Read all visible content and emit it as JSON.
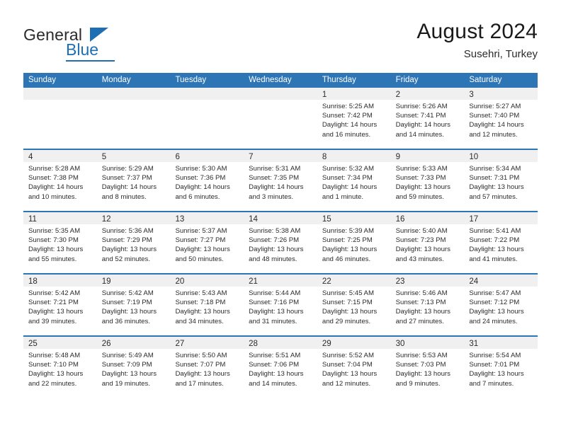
{
  "brand": {
    "name_top": "General",
    "name_bottom": "Blue",
    "triangle_icon": "blue-triangle-icon",
    "accent_color": "#1e6eb4"
  },
  "header": {
    "title": "August 2024",
    "subtitle": "Susehri, Turkey"
  },
  "theme": {
    "header_blue": "#2e75b6",
    "daynum_band": "#f0f0f0",
    "text": "#2b2b2b"
  },
  "calendar": {
    "day_headers": [
      "Sunday",
      "Monday",
      "Tuesday",
      "Wednesday",
      "Thursday",
      "Friday",
      "Saturday"
    ],
    "weeks": [
      [
        {
          "day": "",
          "lines": []
        },
        {
          "day": "",
          "lines": []
        },
        {
          "day": "",
          "lines": []
        },
        {
          "day": "",
          "lines": []
        },
        {
          "day": "1",
          "lines": [
            "Sunrise: 5:25 AM",
            "Sunset: 7:42 PM",
            "Daylight: 14 hours and 16 minutes."
          ]
        },
        {
          "day": "2",
          "lines": [
            "Sunrise: 5:26 AM",
            "Sunset: 7:41 PM",
            "Daylight: 14 hours and 14 minutes."
          ]
        },
        {
          "day": "3",
          "lines": [
            "Sunrise: 5:27 AM",
            "Sunset: 7:40 PM",
            "Daylight: 14 hours and 12 minutes."
          ]
        }
      ],
      [
        {
          "day": "4",
          "lines": [
            "Sunrise: 5:28 AM",
            "Sunset: 7:38 PM",
            "Daylight: 14 hours and 10 minutes."
          ]
        },
        {
          "day": "5",
          "lines": [
            "Sunrise: 5:29 AM",
            "Sunset: 7:37 PM",
            "Daylight: 14 hours and 8 minutes."
          ]
        },
        {
          "day": "6",
          "lines": [
            "Sunrise: 5:30 AM",
            "Sunset: 7:36 PM",
            "Daylight: 14 hours and 6 minutes."
          ]
        },
        {
          "day": "7",
          "lines": [
            "Sunrise: 5:31 AM",
            "Sunset: 7:35 PM",
            "Daylight: 14 hours and 3 minutes."
          ]
        },
        {
          "day": "8",
          "lines": [
            "Sunrise: 5:32 AM",
            "Sunset: 7:34 PM",
            "Daylight: 14 hours and 1 minute."
          ]
        },
        {
          "day": "9",
          "lines": [
            "Sunrise: 5:33 AM",
            "Sunset: 7:33 PM",
            "Daylight: 13 hours and 59 minutes."
          ]
        },
        {
          "day": "10",
          "lines": [
            "Sunrise: 5:34 AM",
            "Sunset: 7:31 PM",
            "Daylight: 13 hours and 57 minutes."
          ]
        }
      ],
      [
        {
          "day": "11",
          "lines": [
            "Sunrise: 5:35 AM",
            "Sunset: 7:30 PM",
            "Daylight: 13 hours and 55 minutes."
          ]
        },
        {
          "day": "12",
          "lines": [
            "Sunrise: 5:36 AM",
            "Sunset: 7:29 PM",
            "Daylight: 13 hours and 52 minutes."
          ]
        },
        {
          "day": "13",
          "lines": [
            "Sunrise: 5:37 AM",
            "Sunset: 7:27 PM",
            "Daylight: 13 hours and 50 minutes."
          ]
        },
        {
          "day": "14",
          "lines": [
            "Sunrise: 5:38 AM",
            "Sunset: 7:26 PM",
            "Daylight: 13 hours and 48 minutes."
          ]
        },
        {
          "day": "15",
          "lines": [
            "Sunrise: 5:39 AM",
            "Sunset: 7:25 PM",
            "Daylight: 13 hours and 46 minutes."
          ]
        },
        {
          "day": "16",
          "lines": [
            "Sunrise: 5:40 AM",
            "Sunset: 7:23 PM",
            "Daylight: 13 hours and 43 minutes."
          ]
        },
        {
          "day": "17",
          "lines": [
            "Sunrise: 5:41 AM",
            "Sunset: 7:22 PM",
            "Daylight: 13 hours and 41 minutes."
          ]
        }
      ],
      [
        {
          "day": "18",
          "lines": [
            "Sunrise: 5:42 AM",
            "Sunset: 7:21 PM",
            "Daylight: 13 hours and 39 minutes."
          ]
        },
        {
          "day": "19",
          "lines": [
            "Sunrise: 5:42 AM",
            "Sunset: 7:19 PM",
            "Daylight: 13 hours and 36 minutes."
          ]
        },
        {
          "day": "20",
          "lines": [
            "Sunrise: 5:43 AM",
            "Sunset: 7:18 PM",
            "Daylight: 13 hours and 34 minutes."
          ]
        },
        {
          "day": "21",
          "lines": [
            "Sunrise: 5:44 AM",
            "Sunset: 7:16 PM",
            "Daylight: 13 hours and 31 minutes."
          ]
        },
        {
          "day": "22",
          "lines": [
            "Sunrise: 5:45 AM",
            "Sunset: 7:15 PM",
            "Daylight: 13 hours and 29 minutes."
          ]
        },
        {
          "day": "23",
          "lines": [
            "Sunrise: 5:46 AM",
            "Sunset: 7:13 PM",
            "Daylight: 13 hours and 27 minutes."
          ]
        },
        {
          "day": "24",
          "lines": [
            "Sunrise: 5:47 AM",
            "Sunset: 7:12 PM",
            "Daylight: 13 hours and 24 minutes."
          ]
        }
      ],
      [
        {
          "day": "25",
          "lines": [
            "Sunrise: 5:48 AM",
            "Sunset: 7:10 PM",
            "Daylight: 13 hours and 22 minutes."
          ]
        },
        {
          "day": "26",
          "lines": [
            "Sunrise: 5:49 AM",
            "Sunset: 7:09 PM",
            "Daylight: 13 hours and 19 minutes."
          ]
        },
        {
          "day": "27",
          "lines": [
            "Sunrise: 5:50 AM",
            "Sunset: 7:07 PM",
            "Daylight: 13 hours and 17 minutes."
          ]
        },
        {
          "day": "28",
          "lines": [
            "Sunrise: 5:51 AM",
            "Sunset: 7:06 PM",
            "Daylight: 13 hours and 14 minutes."
          ]
        },
        {
          "day": "29",
          "lines": [
            "Sunrise: 5:52 AM",
            "Sunset: 7:04 PM",
            "Daylight: 13 hours and 12 minutes."
          ]
        },
        {
          "day": "30",
          "lines": [
            "Sunrise: 5:53 AM",
            "Sunset: 7:03 PM",
            "Daylight: 13 hours and 9 minutes."
          ]
        },
        {
          "day": "31",
          "lines": [
            "Sunrise: 5:54 AM",
            "Sunset: 7:01 PM",
            "Daylight: 13 hours and 7 minutes."
          ]
        }
      ]
    ]
  }
}
